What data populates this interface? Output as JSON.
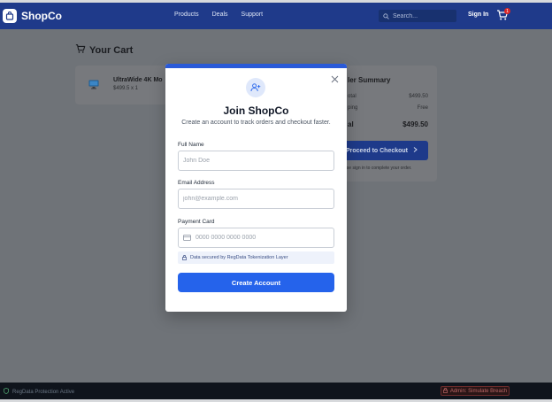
{
  "header": {
    "logo_text": "ShopCo",
    "nav": [
      "Products",
      "Deals",
      "Support"
    ],
    "search_placeholder": "Search...",
    "signin_label": "Sign In",
    "cart_count": "1"
  },
  "cart": {
    "title": "Your Cart",
    "item_name": "UltraWide 4K Mo",
    "item_price": "$499.5 x 1"
  },
  "summary": {
    "title": "ler Summary",
    "subtotal_label": "otal",
    "subtotal_value": "$499.50",
    "shipping_label": "ping",
    "shipping_value": "Free",
    "total_label": "al",
    "total_value": "$499.50",
    "checkout_label": "Proceed to Checkout",
    "checkout_note": "ase sign in to complete your order."
  },
  "modal": {
    "title": "Join ShopCo",
    "subtitle": "Create an account to track orders and checkout faster.",
    "fullname_label": "Full Name",
    "fullname_placeholder": "John Doe",
    "email_label": "Email Address",
    "email_placeholder": "john@example.com",
    "card_label": "Payment Card",
    "card_placeholder": "0000 0000 0000 0000",
    "secure_note": "Data secured by RegData Tokenization Layer",
    "create_label": "Create Account"
  },
  "footer": {
    "protection_text": "RegData Protection Active",
    "breach_label": "Admin: Simulate Breach"
  },
  "colors": {
    "brand": "#1f3a8a",
    "primary": "#2563eb",
    "danger": "#dc2626"
  }
}
